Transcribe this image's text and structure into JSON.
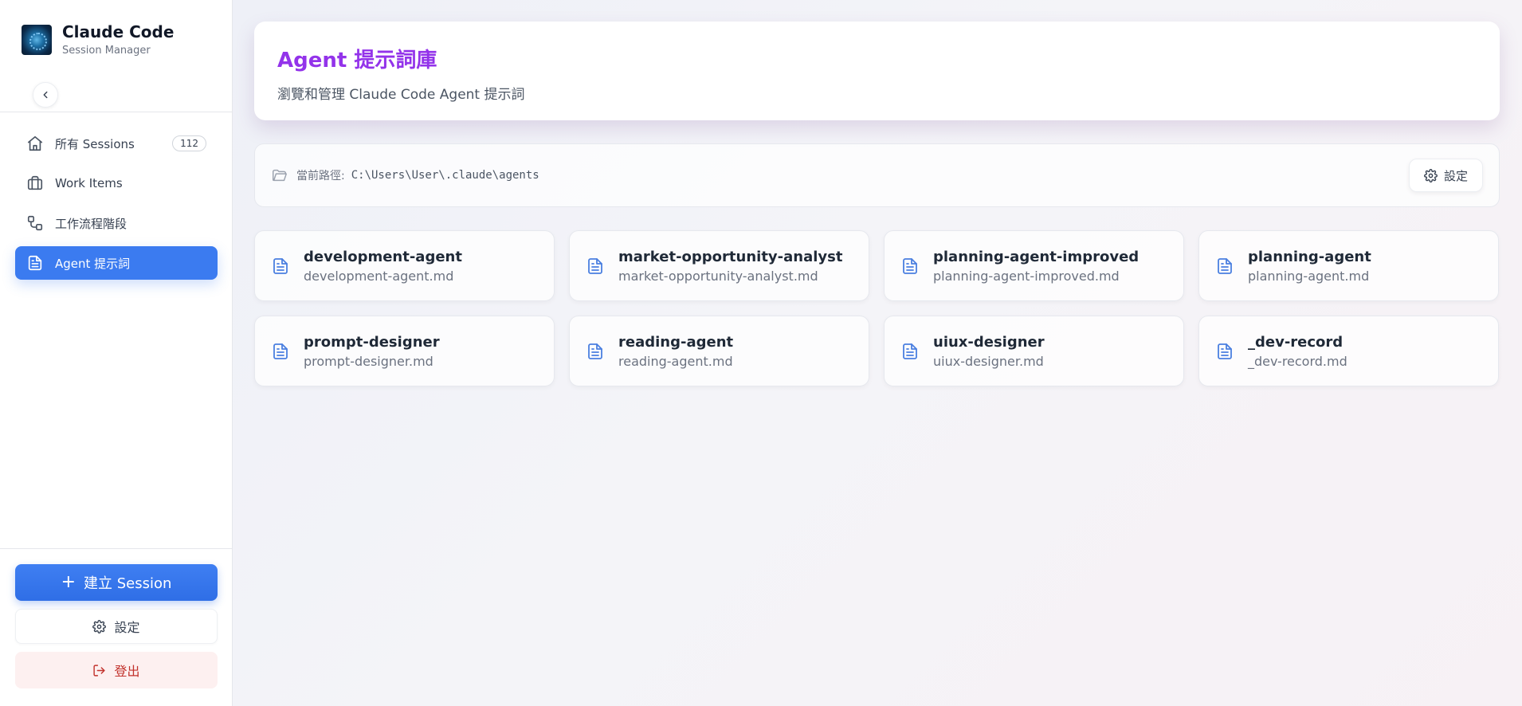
{
  "brand": {
    "title": "Claude Code",
    "subtitle": "Session Manager"
  },
  "nav": [
    {
      "label": "所有 Sessions",
      "icon": "home-icon",
      "badge": "112",
      "active": false
    },
    {
      "label": "Work Items",
      "icon": "briefcase-icon",
      "badge": "",
      "active": false
    },
    {
      "label": "工作流程階段",
      "icon": "workflow-icon",
      "badge": "",
      "active": false
    },
    {
      "label": "Agent 提示詞",
      "icon": "document-icon",
      "badge": "",
      "active": true
    }
  ],
  "sidebar_actions": {
    "create_label": "建立 Session",
    "settings_label": "設定",
    "logout_label": "登出"
  },
  "header": {
    "title": "Agent 提示詞庫",
    "subtitle": "瀏覽和管理 Claude Code Agent 提示詞"
  },
  "path": {
    "label": "當前路徑:",
    "value": "C:\\Users\\User\\.claude\\agents",
    "settings_label": "設定"
  },
  "agents": [
    {
      "name": "development-agent",
      "file": "development-agent.md"
    },
    {
      "name": "market-opportunity-analyst",
      "file": "market-opportunity-analyst.md"
    },
    {
      "name": "planning-agent-improved",
      "file": "planning-agent-improved.md"
    },
    {
      "name": "planning-agent",
      "file": "planning-agent.md"
    },
    {
      "name": "prompt-designer",
      "file": "prompt-designer.md"
    },
    {
      "name": "reading-agent",
      "file": "reading-agent.md"
    },
    {
      "name": "uiux-designer",
      "file": "uiux-designer.md"
    },
    {
      "name": "_dev-record",
      "file": "_dev-record.md"
    }
  ],
  "colors": {
    "accent_blue": "#3b7bf0",
    "title_purple": "#9333ea",
    "logout_red": "#c2322c",
    "file_icon_blue": "#4a7fe0"
  }
}
